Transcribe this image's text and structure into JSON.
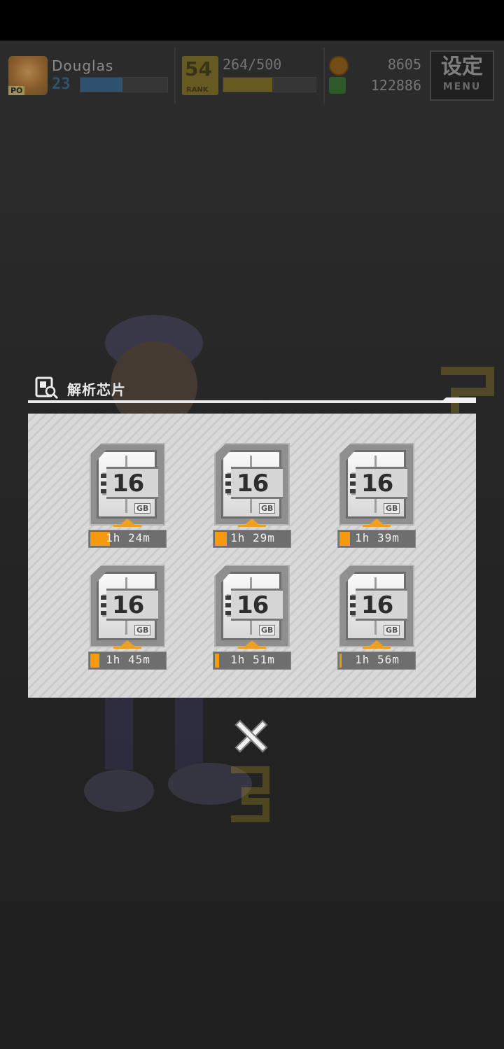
{
  "player": {
    "name": "Douglas",
    "level": "23",
    "exp_fraction": 0.48,
    "avatar_tag": "PO"
  },
  "rank": {
    "number": "54",
    "label": "RANK",
    "progress": "264/500",
    "progress_fraction": 0.528
  },
  "currency": {
    "gold": "8605",
    "silver": "122886"
  },
  "menu": {
    "kanji": "设定",
    "label": "MENU"
  },
  "dialog": {
    "title": "解析芯片",
    "chips": [
      {
        "size": "16",
        "unit": "GB",
        "time": "1h 24m",
        "progress": 0.26
      },
      {
        "size": "16",
        "unit": "GB",
        "time": "1h 29m",
        "progress": 0.16
      },
      {
        "size": "16",
        "unit": "GB",
        "time": "1h 39m",
        "progress": 0.14
      },
      {
        "size": "16",
        "unit": "GB",
        "time": "1h 45m",
        "progress": 0.12
      },
      {
        "size": "16",
        "unit": "GB",
        "time": "1h 51m",
        "progress": 0.06
      },
      {
        "size": "16",
        "unit": "GB",
        "time": "1h 56m",
        "progress": 0.02
      }
    ]
  },
  "colors": {
    "accent": "#f59a0e",
    "exp_bar": "#2f5f86",
    "rank_bar": "#7a6a1a",
    "panel": "#d9d9d9"
  },
  "icons": {
    "title_icon": "chip-search-icon",
    "close": "close-icon",
    "gold": "gold-coin-icon",
    "silver": "green-gem-icon"
  }
}
